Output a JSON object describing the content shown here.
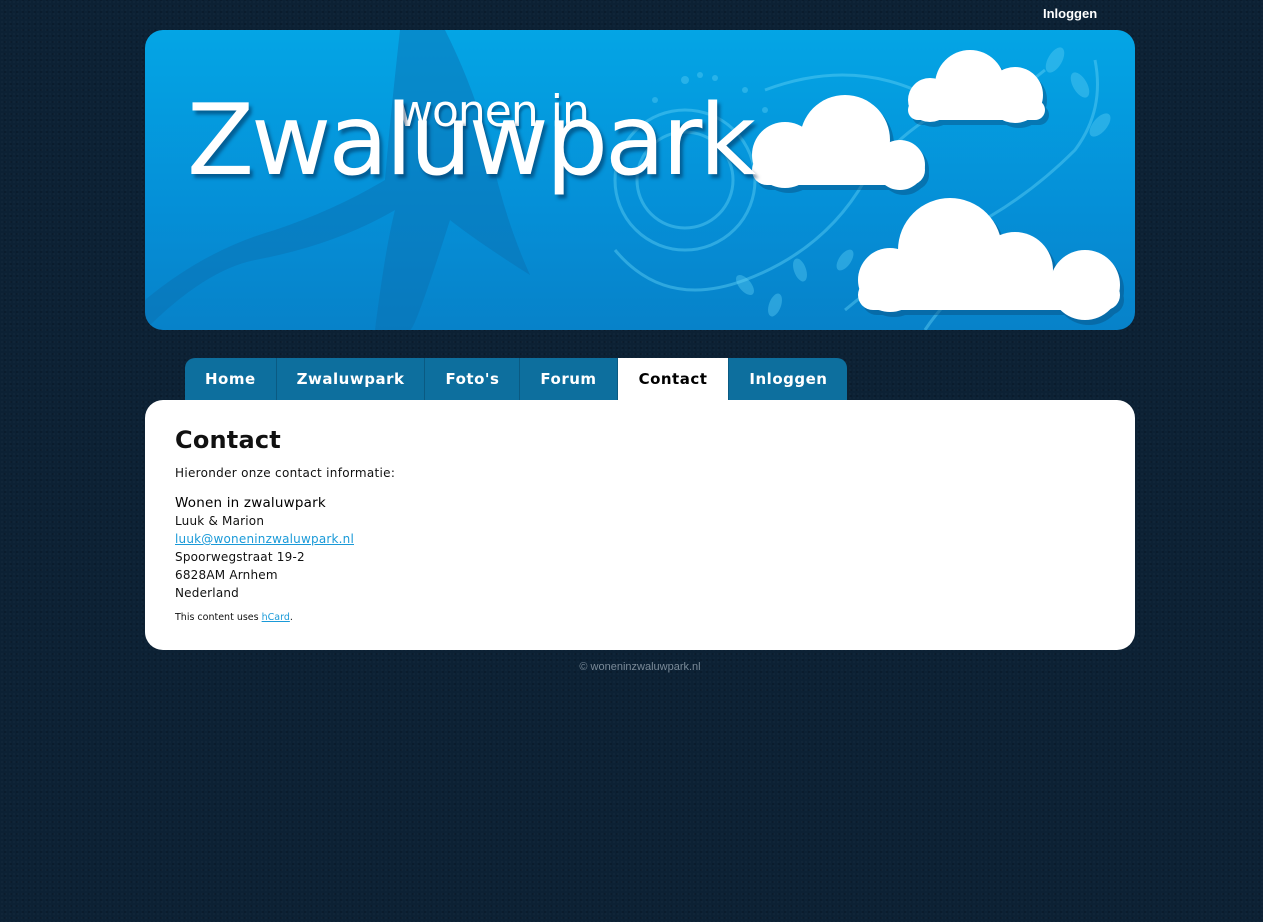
{
  "top_bar": {
    "login_link": "Inloggen"
  },
  "banner": {
    "title_small": "wonen in",
    "title_big": "Zwaluwpark"
  },
  "nav": {
    "items": [
      {
        "label": "Home"
      },
      {
        "label": "Zwaluwpark"
      },
      {
        "label": "Foto's"
      },
      {
        "label": "Forum"
      },
      {
        "label": "Contact",
        "active": true
      },
      {
        "label": "Inloggen"
      }
    ]
  },
  "content": {
    "heading": "Contact",
    "intro": "Hieronder onze contact informatie:",
    "vcard": {
      "org": "Wonen in zwaluwpark",
      "names": "Luuk & Marion",
      "email": "luuk@woneninzwaluwpark.nl",
      "street": "Spoorwegstraat 19-2",
      "city": "6828AM Arnhem",
      "country": "Nederland"
    },
    "hcard_note": {
      "prefix": "This content uses ",
      "link": "hCard",
      "suffix": "."
    }
  },
  "footer": {
    "text": "© woneninzwaluwpark.nl"
  },
  "colors": {
    "background": "#0c2134",
    "banner_blue": "#04a5e5",
    "nav_tab": "#0d6f9e",
    "link": "#1a9ad8"
  }
}
